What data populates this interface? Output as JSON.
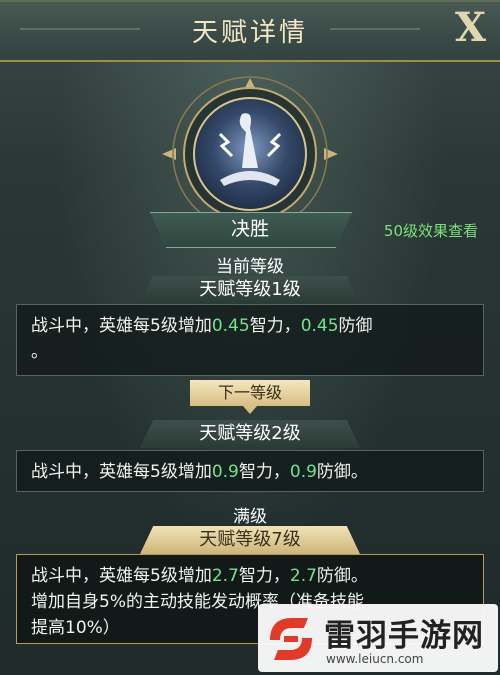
{
  "header": {
    "title": "天赋详情",
    "close_label": "X"
  },
  "talent": {
    "name": "决胜",
    "view_level_link": "50级效果查看"
  },
  "current": {
    "section_label": "当前等级",
    "level_label": "天赋等级1级",
    "desc_prefix": "战斗中，英雄每5级增加",
    "int_value": "0.45",
    "mid_text": "智力，",
    "def_value": "0.45",
    "suffix": "防御",
    "tail": "。"
  },
  "next": {
    "section_label": "下一等级",
    "level_label": "天赋等级2级",
    "desc_prefix": "战斗中，英雄每5级增加",
    "int_value": "0.9",
    "mid_text": "智力，",
    "def_value": "0.9",
    "suffix": "防御。"
  },
  "max": {
    "section_label": "满级",
    "level_label": "天赋等级7级",
    "desc_prefix": "战斗中，英雄每5级增加",
    "int_value": "2.7",
    "mid_text": "智力，",
    "def_value": "2.7",
    "suffix": "防御。",
    "line2": "增加自身5%的主动技能发动概率（准备技能",
    "line3": "提高10%）"
  },
  "watermark": {
    "title": "雷羽手游网",
    "url": "www.leiucn.com"
  },
  "colors": {
    "highlight": "#6fe68a",
    "gold": "#cdb57a",
    "link": "#7fe07f"
  }
}
